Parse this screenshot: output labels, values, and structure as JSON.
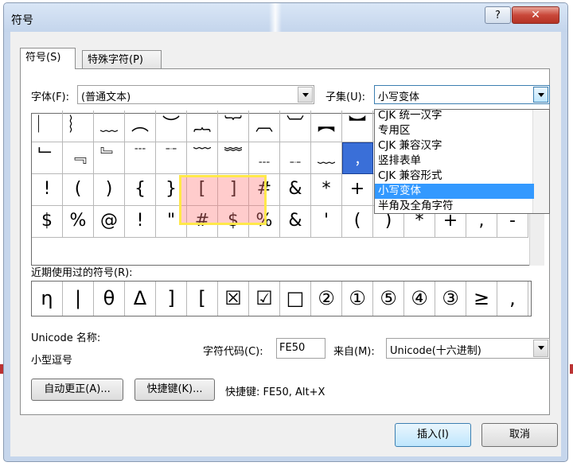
{
  "dialog": {
    "title": "符号",
    "help_label": "?",
    "close_label": "✕",
    "tabs": [
      {
        "label": "符号(S)",
        "active": true
      },
      {
        "label": "特殊字符(P)",
        "active": false
      }
    ]
  },
  "font": {
    "label": "字体(F):",
    "value": "(普通文本)"
  },
  "subset": {
    "label": "子集(U):",
    "value": "小写变体",
    "options": [
      "CJK 统一汉字",
      "专用区",
      "CJK 兼容汉字",
      "竖排表单",
      "CJK 兼容形式",
      "小写变体",
      "半角及全角字符"
    ],
    "selected_index": 5
  },
  "symbol_grid": {
    "rows": [
      [
        "︳",
        "︴",
        "﹏",
        "︵",
        "︶",
        "︷",
        "︸",
        "︹",
        "︺",
        "︻",
        "︼",
        "︽",
        "︾",
        "︿",
        "﹀",
        "﹁"
      ],
      [
        "﹂",
        "﹃",
        "﹄",
        "﹉",
        "﹊",
        "﹋",
        "﹌",
        "﹍",
        "﹎",
        "﹏",
        "﹐",
        "﹑",
        "﹒",
        "﹔",
        "﹕",
        "﹖"
      ],
      [
        "!",
        "(",
        ")",
        "{",
        "}",
        "[",
        "]",
        "#",
        "&",
        "*",
        "+",
        "-",
        "<",
        ">",
        "=",
        "\\"
      ],
      [
        "$",
        "%",
        "@",
        "!",
        "\"",
        "#",
        "$",
        "%",
        "&",
        "'",
        "(",
        ")",
        "*",
        "+",
        ",",
        "-"
      ]
    ],
    "selected": {
      "row": 1,
      "col": 10
    }
  },
  "recent": {
    "label": "近期使用过的符号(R):",
    "items": [
      "η",
      "|",
      "θ",
      "Δ",
      "]",
      "[",
      "☒",
      "☑",
      "□",
      "②",
      "①",
      "⑤",
      "④",
      "③",
      "≥",
      ","
    ]
  },
  "unicode_name": {
    "label": "Unicode 名称:",
    "value": "小型逗号"
  },
  "char_code": {
    "label": "字符代码(C):",
    "value": "FE50"
  },
  "from": {
    "label": "来自(M):",
    "value": "Unicode(十六进制)"
  },
  "buttons": {
    "autocorrect": "自动更正(A)...",
    "shortcut_key": "快捷键(K)...",
    "insert": "插入(I)",
    "cancel": "取消"
  },
  "shortcut_info": "快捷键: FE50, Alt+X"
}
